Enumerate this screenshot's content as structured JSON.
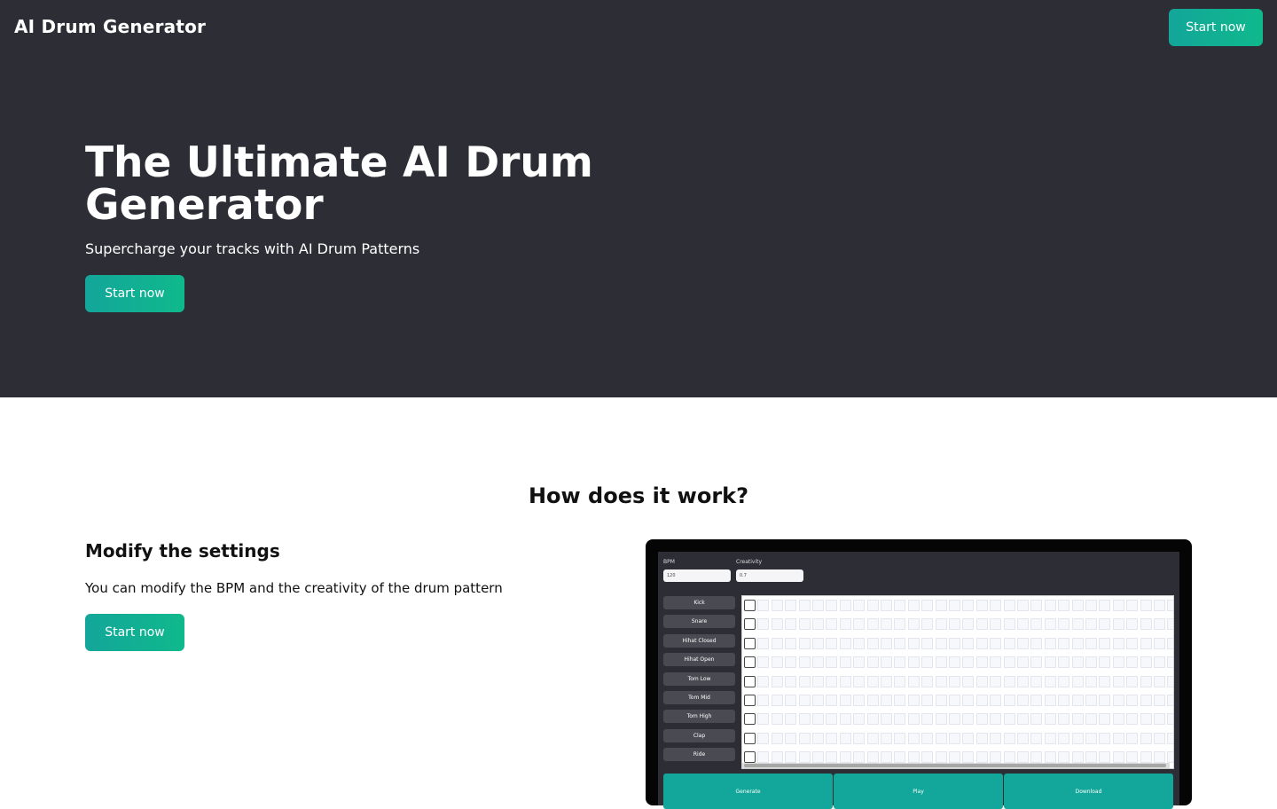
{
  "header": {
    "brand": "AI Drum Generator",
    "cta_label": "Start now"
  },
  "hero": {
    "title": "The Ultimate AI Drum Generator",
    "subtitle": "Supercharge your tracks with AI Drum Patterns",
    "cta_label": "Start now"
  },
  "how": {
    "title": "How does it work?",
    "step": {
      "title": "Modify the settings",
      "text": "You can modify the BPM and the creativity of the drum pattern",
      "cta_label": "Start now"
    }
  },
  "app_preview": {
    "bpm_label": "BPM",
    "bpm_value": "120",
    "creativity_label": "Creativity",
    "creativity_value": "0.7",
    "tracks": [
      "Kick",
      "Snare",
      "Hihat Closed",
      "Hihat Open",
      "Tom Low",
      "Tom Mid",
      "Tom High",
      "Clap",
      "Ride"
    ],
    "steps_visible": 32,
    "actions": [
      "Generate",
      "Play",
      "Download"
    ]
  },
  "colors": {
    "hero_bg": "#2d2d36",
    "accent": "#13a69a",
    "accent_end": "#0fb98c"
  }
}
